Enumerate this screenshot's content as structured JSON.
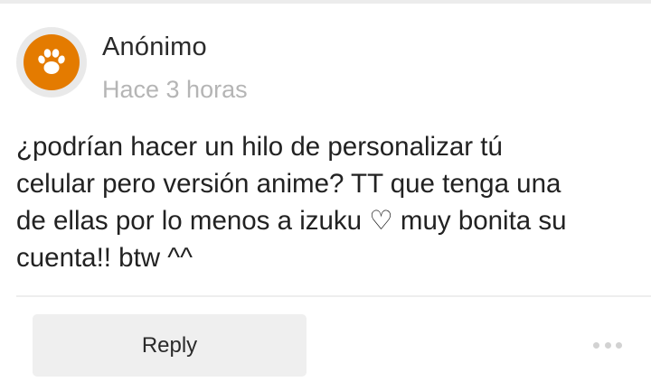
{
  "comment": {
    "author": "Anónimo",
    "timestamp": "Hace 3 horas",
    "avatar_icon": "paw-icon",
    "avatar_color": "#e47b00",
    "lines": [
      "¿podrían hacer un hilo de personalizar tú",
      "celular pero versión anime? TT que tenga una",
      "de ellas por lo menos a izuku ♡ muy bonita su",
      "cuenta!! btw ^^"
    ]
  },
  "actions": {
    "reply_label": "Reply",
    "more_icon": "more-horizontal-icon"
  }
}
